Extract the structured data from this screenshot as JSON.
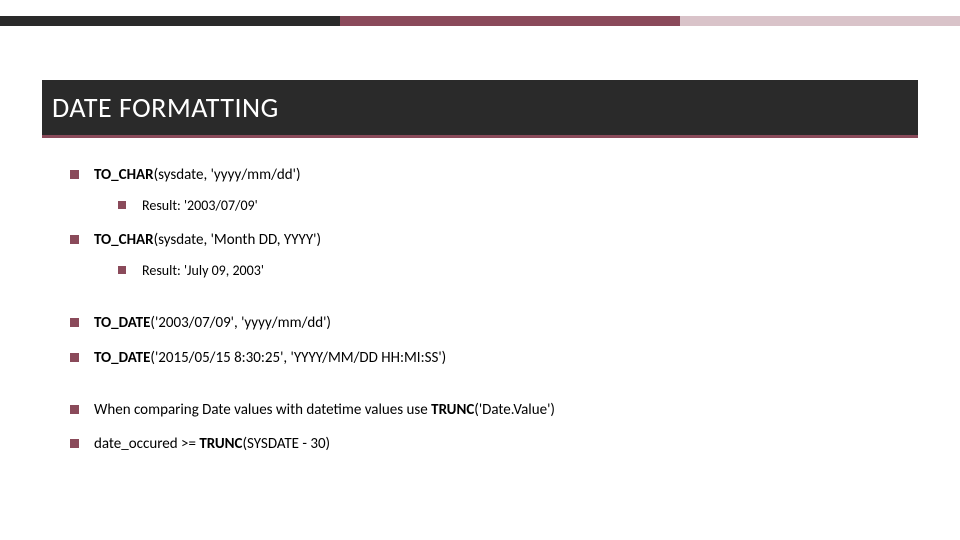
{
  "title": "DATE FORMATTING",
  "items": [
    {
      "prefix": "TO_CHAR",
      "suffix": "(sysdate, 'yyyy/mm/dd')",
      "sub": "Result: '2003/07/09'"
    },
    {
      "prefix": "TO_CHAR",
      "suffix": "(sysdate, 'Month DD, YYYY')",
      "sub": "Result: 'July 09, 2003'"
    },
    {
      "prefix": "TO_DATE",
      "suffix": "('2003/07/09', 'yyyy/mm/dd')"
    },
    {
      "prefix": "TO_DATE",
      "suffix": "('2015/05/15 8:30:25', 'YYYY/MM/DD HH:MI:SS')"
    },
    {
      "plain_before": "When comparing Date values with datetime values use ",
      "bold": "TRUNC",
      "plain_after": "('Date.Value')"
    },
    {
      "plain_before": "date_occured >= ",
      "bold": "TRUNC",
      "plain_after": "(SYSDATE - 30)"
    }
  ]
}
